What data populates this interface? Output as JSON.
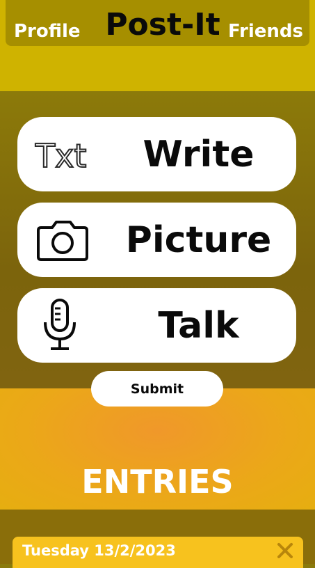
{
  "nav": {
    "profile": "Profile",
    "brand": "Post-It",
    "friends": "Friends"
  },
  "options": [
    {
      "label": "Write",
      "icon": "text-icon",
      "icon_text": "Txt"
    },
    {
      "label": "Picture",
      "icon": "camera-icon"
    },
    {
      "label": "Talk",
      "icon": "microphone-icon"
    }
  ],
  "submit": "Submit",
  "entries": {
    "title": "ENTRIES",
    "items": [
      {
        "date": "Tuesday 13/2/2023"
      }
    ]
  },
  "colors": {
    "header": "#cfb300",
    "navbar": "#a68f00",
    "panel": "#8a7a0c",
    "entries_band": "#f0982a",
    "entry_card": "#f7c21e"
  }
}
